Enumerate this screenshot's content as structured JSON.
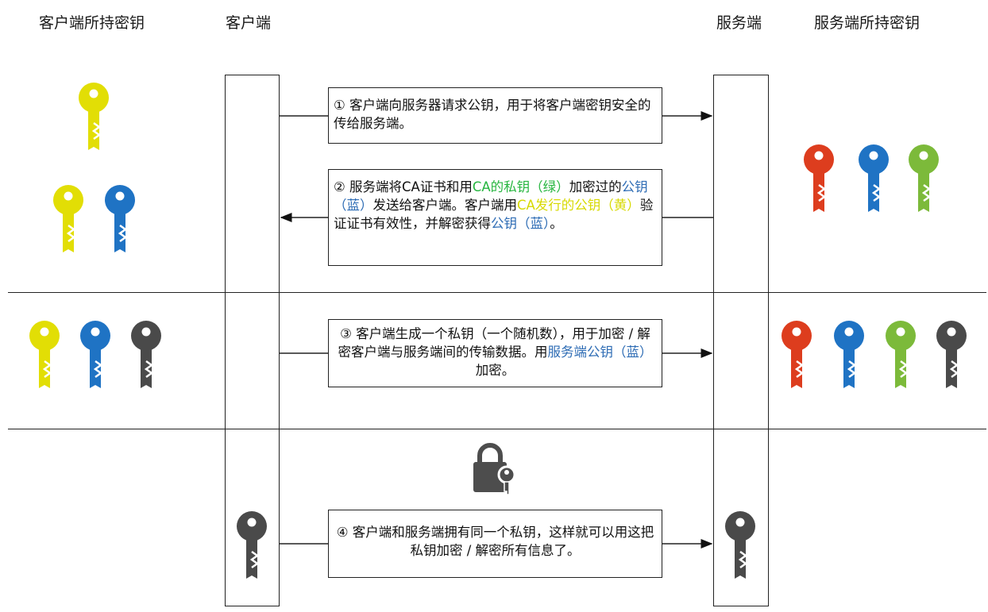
{
  "headers": {
    "client_keys": "客户端所持密钥",
    "client": "客户端",
    "server": "服务端",
    "server_keys": "服务端所持密钥"
  },
  "messages": [
    {
      "segments": [
        {
          "text": "① 客户端向服务器请求公钥，用于将客户端密钥安全的传给服务端。",
          "color": "default"
        }
      ]
    },
    {
      "segments": [
        {
          "text": "② 服务端将CA证书和用",
          "color": "default"
        },
        {
          "text": "CA的私钥（绿）",
          "color": "green"
        },
        {
          "text": "加密过的",
          "color": "default"
        },
        {
          "text": "公钥（蓝）",
          "color": "blue"
        },
        {
          "text": "发送给客户端。客户端用",
          "color": "default"
        },
        {
          "text": "CA发行的公钥（黄）",
          "color": "yellow"
        },
        {
          "text": "验证证书有效性，并解密获得",
          "color": "default"
        },
        {
          "text": "公钥（蓝）",
          "color": "blue"
        },
        {
          "text": "。",
          "color": "default"
        }
      ]
    },
    {
      "segments": [
        {
          "text": "③ 客户端生成一个私钥（一个随机数），用于加密 / 解密客户端与服务端间的传输数据。用",
          "color": "default"
        },
        {
          "text": "服务端公钥（蓝）",
          "color": "blue"
        },
        {
          "text": "加密。",
          "color": "default"
        }
      ]
    },
    {
      "segments": [
        {
          "text": "④ 客户端和服务端拥有同一个私钥，这样就可以用这把私钥加密 / 解密所有信息了。",
          "color": "default"
        }
      ]
    }
  ],
  "colors": {
    "yellow_key": "#e2de05",
    "blue_key": "#1f73c4",
    "green_key": "#7cba3a",
    "red_key": "#dd3d1e",
    "dark_key": "#4a4a4a",
    "lock": "#4d4d4d",
    "text_blue": "#2f6db5",
    "text_green": "#27b640",
    "text_yellow": "#d7d900"
  },
  "keys": {
    "client_row1": [
      "yellow"
    ],
    "client_row2": [
      "yellow",
      "blue"
    ],
    "server_row1": [
      "red",
      "blue",
      "green"
    ],
    "client_row3": [
      "yellow",
      "blue",
      "dark"
    ],
    "server_row3": [
      "red",
      "blue",
      "green",
      "dark"
    ],
    "client_row4": [
      "dark"
    ],
    "server_row4": [
      "dark"
    ]
  },
  "icons": [
    "key-icon",
    "padlock-icon"
  ]
}
